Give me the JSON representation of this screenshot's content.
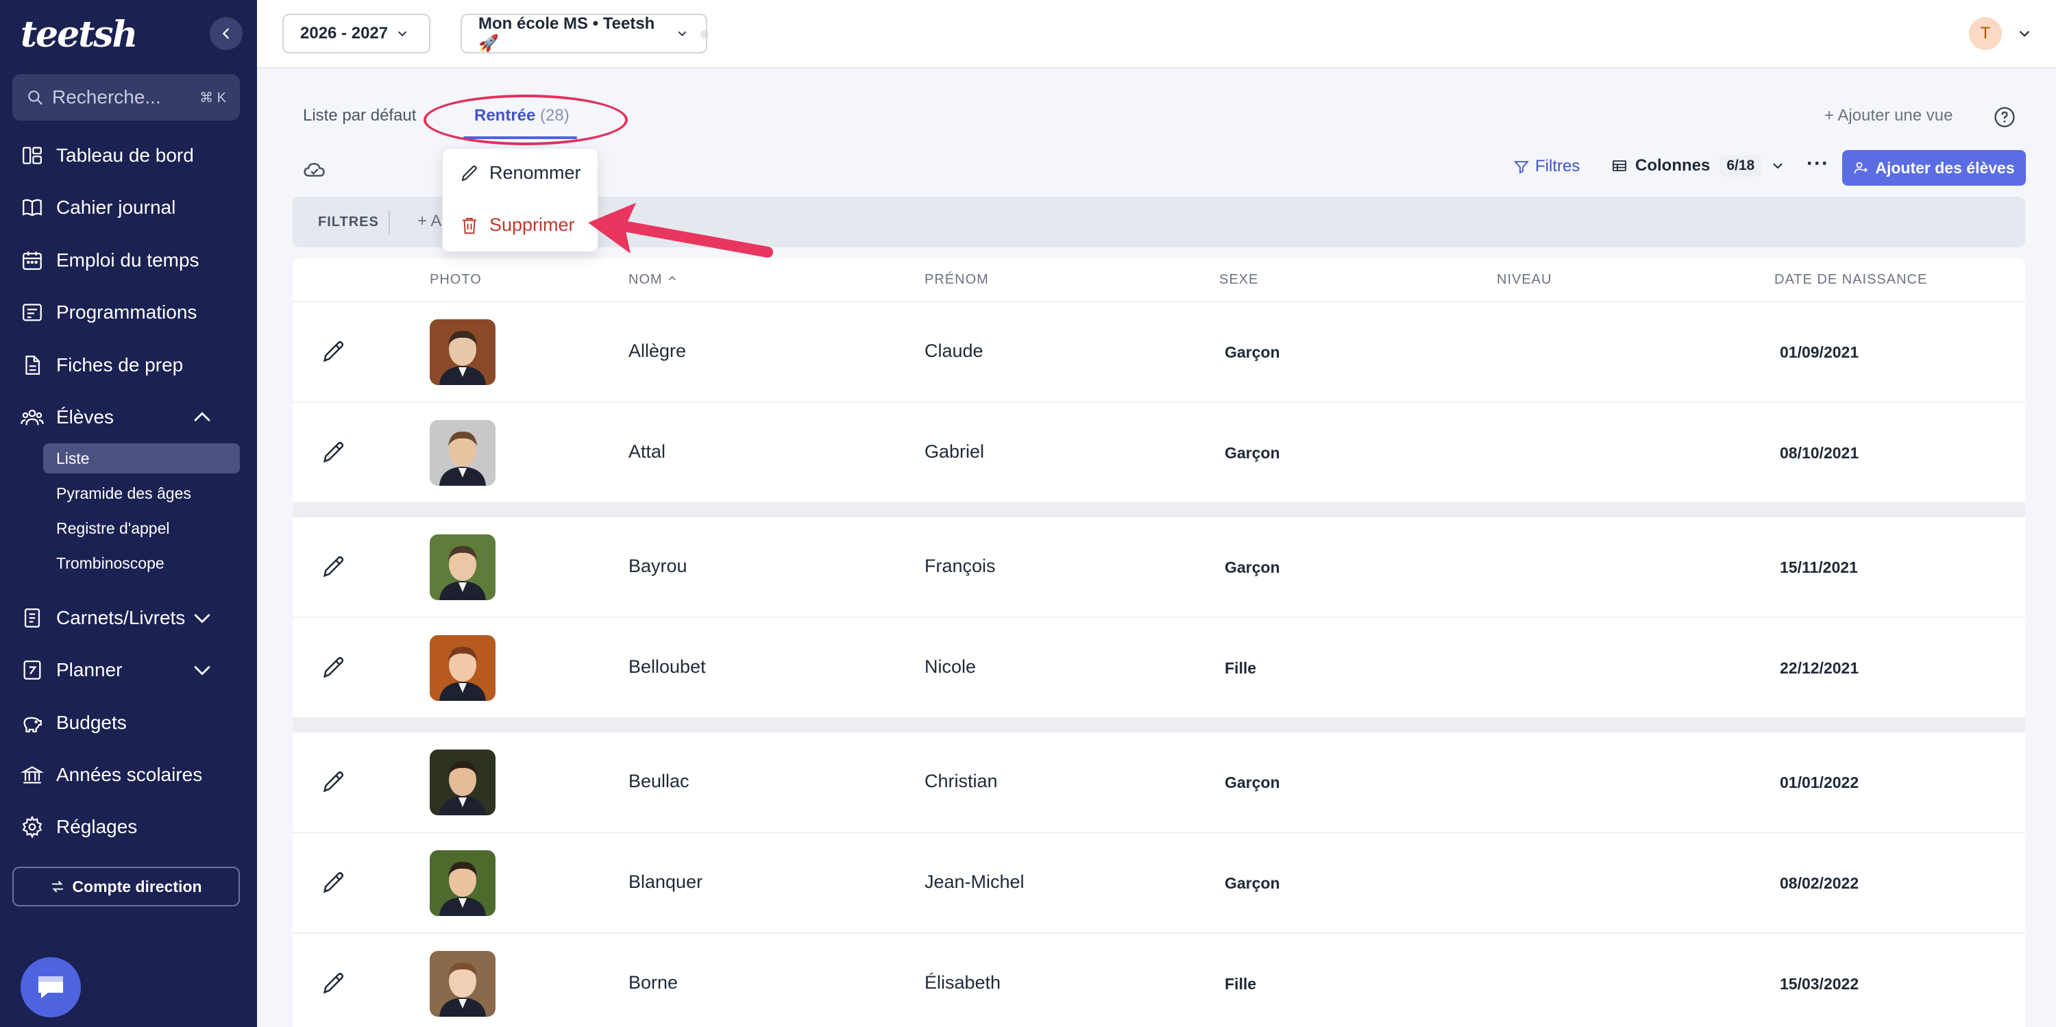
{
  "app": {
    "logo": "teetsh"
  },
  "sidebar": {
    "search_placeholder": "Recherche...",
    "search_shortcut": "⌘ K",
    "items": [
      {
        "label": "Tableau de bord",
        "icon": "dashboard-icon"
      },
      {
        "label": "Cahier journal",
        "icon": "book-icon"
      },
      {
        "label": "Emploi du temps",
        "icon": "calendar-icon"
      },
      {
        "label": "Programmations",
        "icon": "programming-icon"
      },
      {
        "label": "Fiches de prep",
        "icon": "document-icon"
      },
      {
        "label": "Élèves",
        "icon": "users-icon"
      },
      {
        "label": "Carnets/Livrets",
        "icon": "notebook-icon"
      },
      {
        "label": "Planner",
        "icon": "planner-icon"
      },
      {
        "label": "Budgets",
        "icon": "piggy-bank-icon"
      },
      {
        "label": "Années scolaires",
        "icon": "school-icon"
      },
      {
        "label": "Réglages",
        "icon": "gear-icon"
      }
    ],
    "sub_items": [
      "Liste",
      "Pyramide des âges",
      "Registre d'appel",
      "Trombinoscope"
    ],
    "compte_button": "Compte direction"
  },
  "topbar": {
    "year_select": "2026 - 2027",
    "school_select": "Mon école MS • Teetsh 🚀",
    "avatar_initial": "T"
  },
  "tabs": {
    "default": "Liste par défaut",
    "active": "Rentrée",
    "active_count": "(28)",
    "add_view": "Ajouter une vue"
  },
  "toolbar": {
    "filters": "Filtres",
    "columns": "Colonnes",
    "columns_count": "6/18",
    "more": "···",
    "add_students": "Ajouter des élèves"
  },
  "filters_bar": {
    "label": "FILTRES",
    "add": "+ A"
  },
  "dropdown": {
    "rename": "Renommer",
    "delete": "Supprimer"
  },
  "table": {
    "headers": {
      "photo": "PHOTO",
      "nom": "NOM",
      "prenom": "PRÉNOM",
      "sexe": "SEXE",
      "niveau": "NIVEAU",
      "naissance": "DATE DE NAISSANCE"
    },
    "rows": [
      {
        "nom": "Allègre",
        "prenom": "Claude",
        "sexe": "Garçon",
        "niveau": "",
        "naissance": "01/09/2021"
      },
      {
        "nom": "Attal",
        "prenom": "Gabriel",
        "sexe": "Garçon",
        "niveau": "",
        "naissance": "08/10/2021"
      },
      {
        "nom": "Bayrou",
        "prenom": "François",
        "sexe": "Garçon",
        "niveau": "",
        "naissance": "15/11/2021"
      },
      {
        "nom": "Belloubet",
        "prenom": "Nicole",
        "sexe": "Fille",
        "niveau": "",
        "naissance": "22/12/2021"
      },
      {
        "nom": "Beullac",
        "prenom": "Christian",
        "sexe": "Garçon",
        "niveau": "",
        "naissance": "01/01/2022"
      },
      {
        "nom": "Blanquer",
        "prenom": "Jean-Michel",
        "sexe": "Garçon",
        "niveau": "",
        "naissance": "08/02/2022"
      },
      {
        "nom": "Borne",
        "prenom": "Élisabeth",
        "sexe": "Fille",
        "niveau": "",
        "naissance": "15/03/2022"
      }
    ]
  },
  "colors": {
    "sidebar_bg": "#1b2252",
    "accent": "#5a6de3",
    "annotation": "#e1325b",
    "danger": "#c0392b"
  }
}
